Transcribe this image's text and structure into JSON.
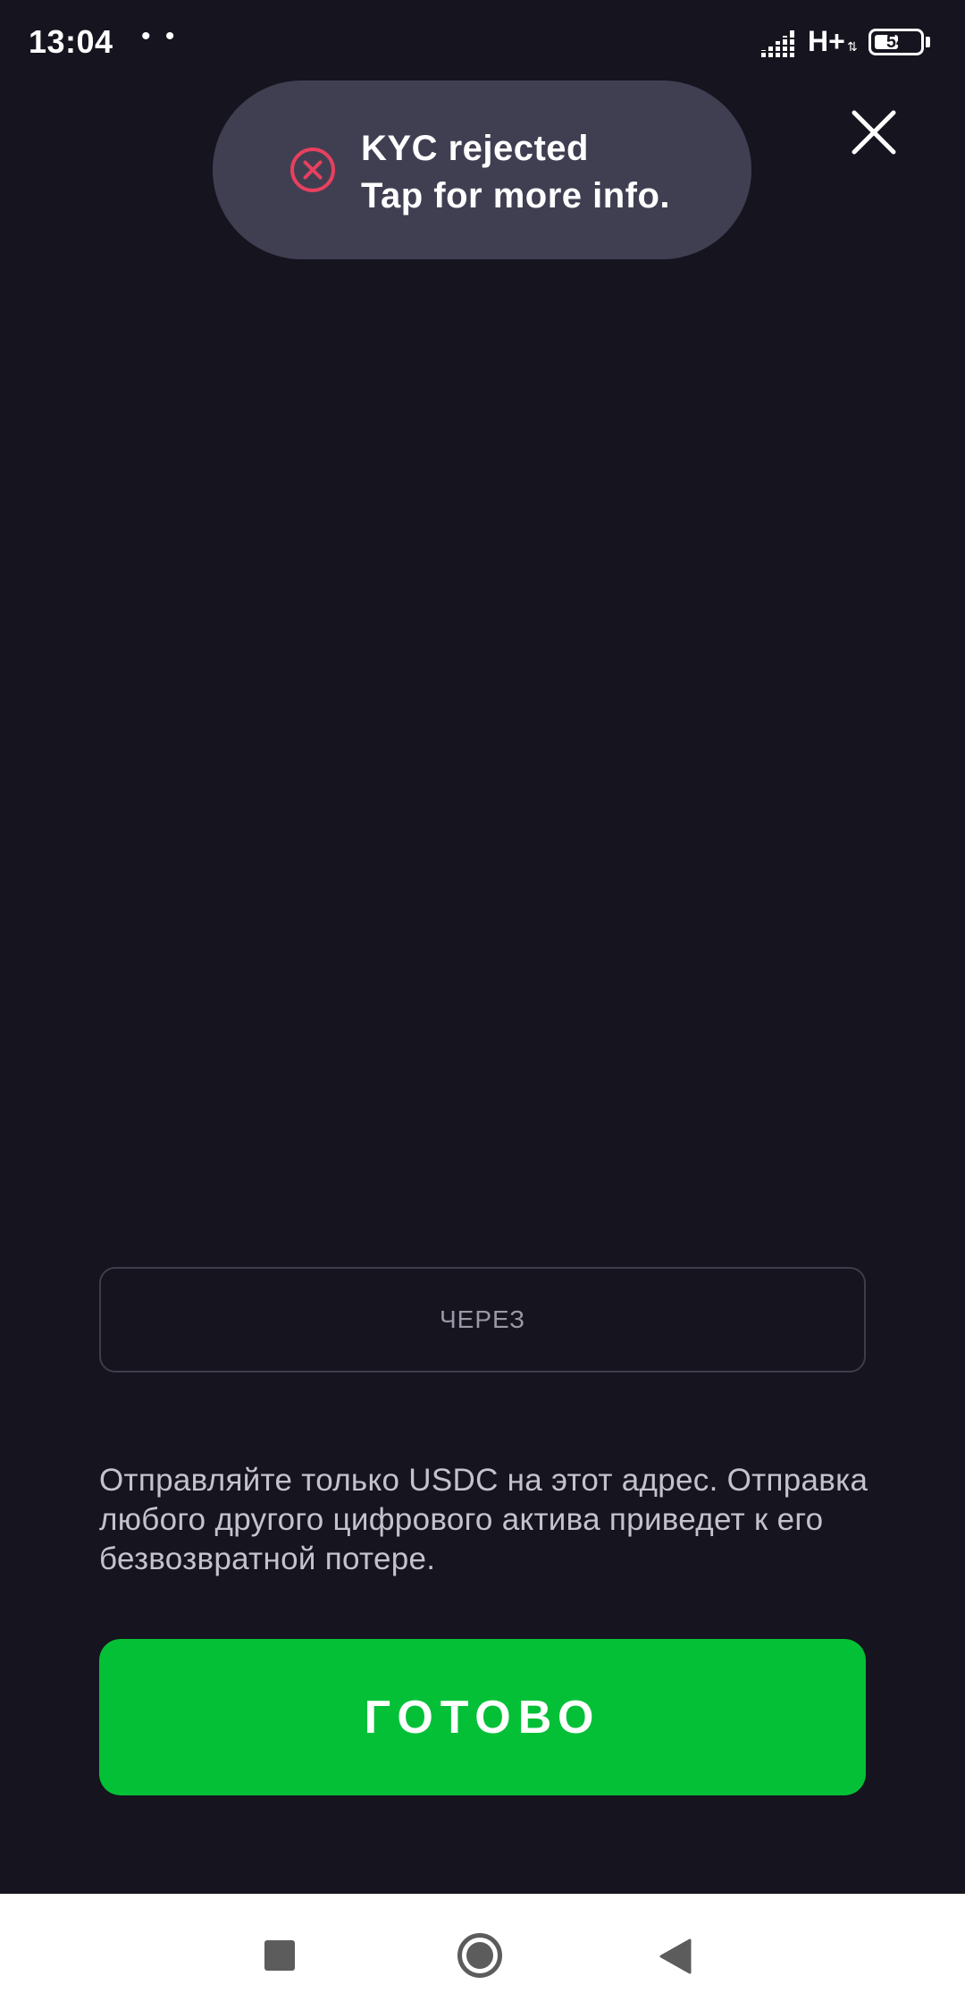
{
  "status_bar": {
    "time": "13:04",
    "dots": "• •",
    "network_type": "H+",
    "battery_level": "54",
    "battery_fraction": 0.54
  },
  "toast": {
    "icon": "error-circle-x-icon",
    "title": "KYC rejected",
    "subtitle": "Tap for more info.",
    "icon_color": "#e8405f",
    "background": "#403f52"
  },
  "close": {
    "icon": "close-icon"
  },
  "via_field": {
    "label": "ЧЕРЕЗ"
  },
  "warning": {
    "lines": [
      "Отправляйте только USDC на этот адрес. Отправка",
      "любого другого цифрового актива приведет к его",
      "безвозвратной потере."
    ]
  },
  "done_button": {
    "label": "ГОТОВО",
    "color": "#04c037"
  },
  "nav_bar": {
    "recents_icon": "square-recents-icon",
    "home_icon": "circle-home-icon",
    "back_icon": "triangle-back-icon"
  },
  "colors": {
    "background": "#15141f",
    "text_primary": "#ffffff",
    "text_secondary": "#c4c3cd"
  }
}
